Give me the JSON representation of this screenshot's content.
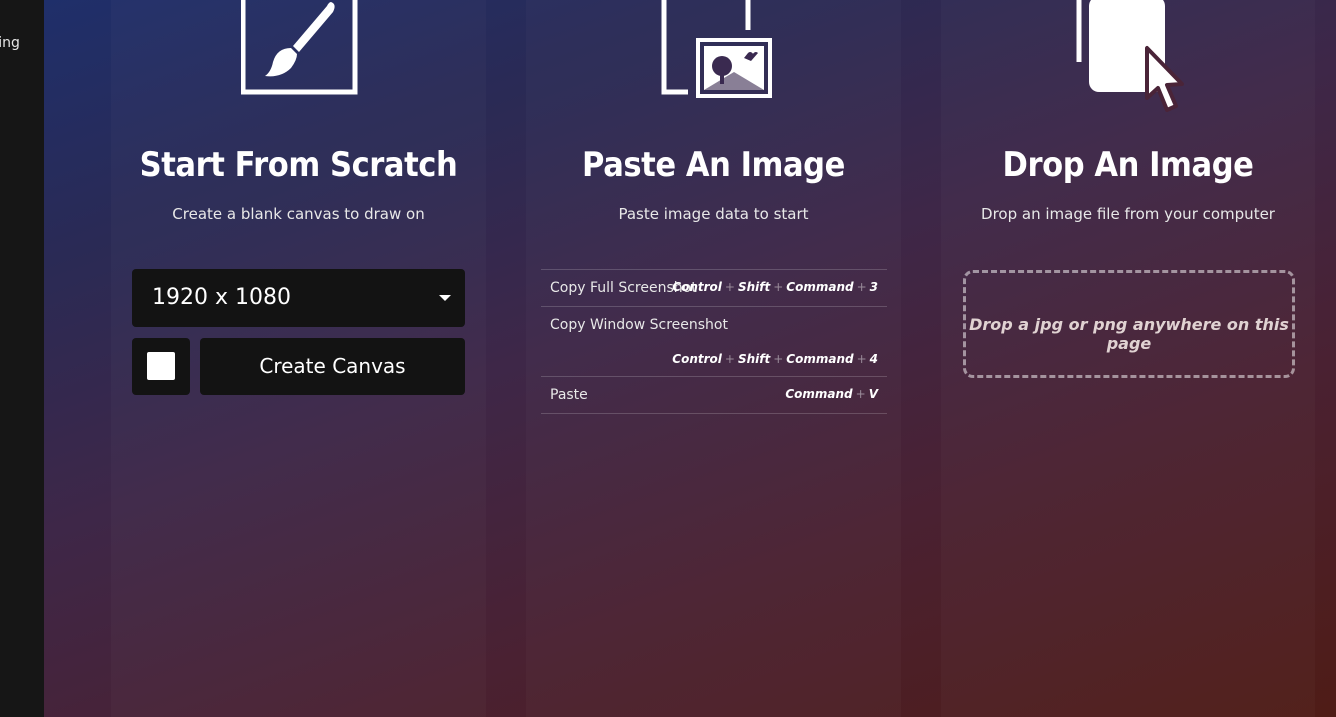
{
  "sidebar": {
    "partial_text": "ving"
  },
  "scratch": {
    "title": "Start From Scratch",
    "subtitle": "Create a blank canvas to draw on",
    "size_value": "1920 x 1080",
    "create_label": "Create Canvas"
  },
  "paste": {
    "title": "Paste An Image",
    "subtitle": "Paste image data to start",
    "shortcuts": [
      {
        "label": "Copy Full Screenshot",
        "keys": [
          "Control",
          "Shift",
          "Command",
          "3"
        ]
      },
      {
        "label": "Copy Window Screenshot",
        "keys": [
          "Control",
          "Shift",
          "Command",
          "4"
        ]
      },
      {
        "label": "Paste",
        "keys": [
          "Command",
          "V"
        ]
      }
    ],
    "plus": "+"
  },
  "drop": {
    "title": "Drop An Image",
    "subtitle": "Drop an image file from your computer",
    "zone_text": "Drop a jpg or png anywhere on this page"
  },
  "colors": {
    "sidebar_bg": "#161616",
    "control_bg": "#131313",
    "text": "#ffffff"
  },
  "icons": [
    "paintbrush-canvas-icon",
    "clipboard-image-icon",
    "document-cursor-icon",
    "caret-down-icon"
  ]
}
